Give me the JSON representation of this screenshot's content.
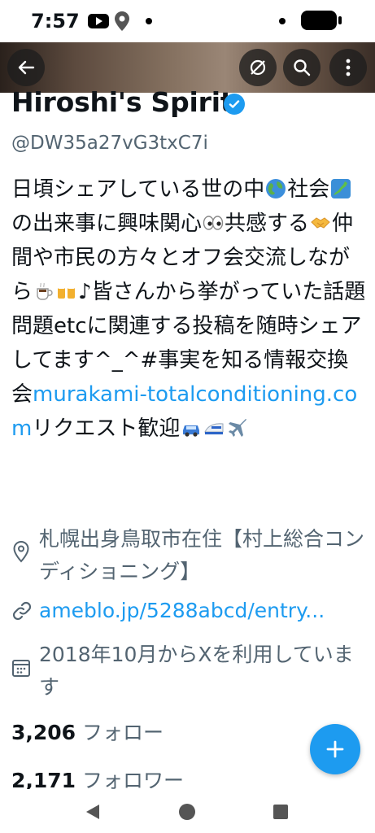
{
  "status_bar": {
    "time": "7:57"
  },
  "profile": {
    "name": "Hiroshi's Spirit",
    "handle": "@DW35a27vG3txC7i",
    "bio_parts": [
      "日頃シェアしている世の中",
      "社会",
      "の出来事に興味関心",
      "共感する",
      "仲間や市民の方々とオフ会交流しながら",
      "♪皆さんから挙がっていた話題問題etcに関連する投稿を随時シェアしてます^_^#事実を知る情報交換会",
      "murakami-totalconditioning.com",
      "リクエスト歓迎"
    ],
    "location": "札幌出身鳥取市在住【村上総合コンディショニング】",
    "website": "ameblo.jp/5288abcd/entry...",
    "joined": "2018年10月からXを利用しています",
    "following_count": "3,206",
    "following_label": "フォロー",
    "followers_count": "2,171",
    "followers_label": "フォロワー"
  },
  "colors": {
    "accent": "#1d9bf0",
    "text": "#0f1419",
    "secondary": "#536471"
  }
}
